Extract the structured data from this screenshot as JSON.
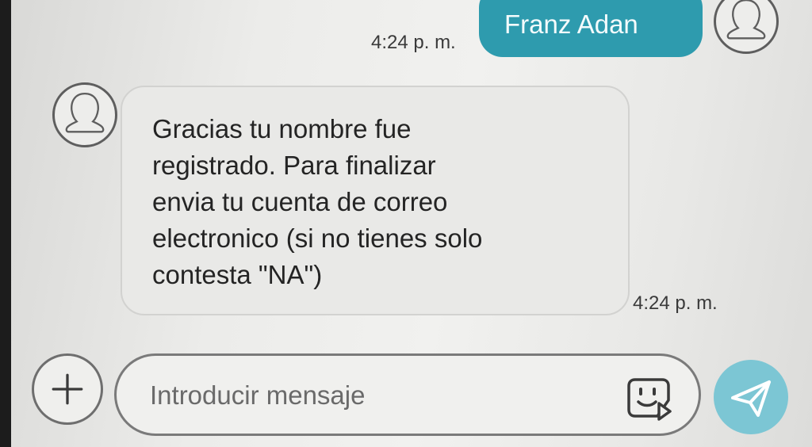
{
  "conversation": {
    "sent_message": {
      "text": "Franz Adan",
      "time": "4:24 p. m."
    },
    "received_message": {
      "lines": [
        "Gracias tu nombre fue",
        "registrado. Para finalizar",
        "envia tu cuenta de correo",
        "electronico (si no tienes solo",
        "contesta \"NA\")"
      ],
      "time": "4:24 p. m."
    }
  },
  "composer": {
    "placeholder": "Introducir mensaje"
  },
  "icons": {
    "attach": "plus-icon",
    "sticker": "sticker-icon",
    "send": "send-icon",
    "avatar": "user-avatar-icon"
  },
  "colors": {
    "sent_bubble": "#2e9bae",
    "received_bubble": "#e9e9e7",
    "send_button": "#7cc6d4"
  }
}
